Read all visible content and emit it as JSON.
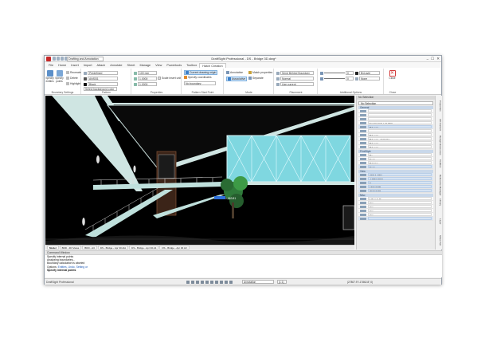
{
  "window": {
    "title": "DraftSight Professional - DS - Bridge 3D.dwg*",
    "workspace": "Drafting and Annotation",
    "controls": [
      "–",
      "☐",
      "✕"
    ]
  },
  "ribbon_tabs": [
    "File",
    "Home",
    "Insert",
    "Import",
    "Attach",
    "Annotate",
    "Sheet",
    "Manage",
    "View",
    "Powertools",
    "Toolbox",
    "Hatch Creation"
  ],
  "ribbon_active_tab": "Hatch Creation",
  "ribbon": {
    "boundary": {
      "label": "Boundary Settings",
      "specify_entities": "Specify entities",
      "specify_points": "Specify points",
      "options": [
        "Recreate",
        "Delete",
        "Highlight"
      ]
    },
    "pattern": {
      "label": "Pattern",
      "type": "Predefined",
      "name": "ANSI31",
      "color": "Black",
      "background": "Select background color"
    },
    "properties": {
      "label": "Properties",
      "angle": "100 mm",
      "scale": "1.0000",
      "spacing": "1.0000",
      "scale_insert": "Scale insert unit"
    },
    "origin": {
      "label": "Pattern Start Point",
      "current_drawing_origin": "Current drawing origin",
      "specify_coordinates": "Specify coordinates",
      "no_boundary": "No boundary"
    },
    "mode": {
      "label": "Mode",
      "annotative": "Annotative",
      "associative": "Associative",
      "match_properties": "Match properties",
      "separate": "Separate"
    },
    "placement": {
      "label": "Placement",
      "order": "Send Behind Boundary",
      "normal": "Normal",
      "layer": "Use current"
    },
    "additional": {
      "label": "Additional Options",
      "color_by": "ByLayer",
      "layer_value": "0",
      "gap": "0",
      "linetype": "None"
    },
    "close": {
      "label": "Close",
      "button": "Close"
    }
  },
  "layout_tabs": [
    "Model",
    "BDD - 3D Views",
    "BDD - A3",
    "DS - Bridge - Apr 30 AIA",
    "DS - Bridge - Apr 30 A4",
    "DS - Bridge - Apr 30 A3"
  ],
  "layout_active": "Model",
  "properties_panel": {
    "header": "No Selection",
    "selection": "No Selection",
    "sections": [
      {
        "title": "General",
        "rows": [
          {
            "value": "",
            "highlight": false
          },
          {
            "value": "",
            "highlight": false
          },
          {
            "value": "",
            "highlight": false
          },
          {
            "value": "Small Hatch Left Wall",
            "highlight": false
          },
          {
            "value": "ByLayer",
            "highlight": true
          },
          {
            "value": "",
            "highlight": false
          },
          {
            "value": "ByLayer",
            "highlight": false
          },
          {
            "value": "ByLayer - Solid line",
            "highlight": false
          },
          {
            "value": "ByLayer",
            "highlight": false
          },
          {
            "value": "ByLayer",
            "highlight": false
          }
        ]
      },
      {
        "title": "PrintStyle",
        "rows": [
          {
            "value": "By",
            "highlight": false
          },
          {
            "value": "None",
            "highlight": false
          },
          {
            "value": "ByColor",
            "highlight": false
          },
          {
            "value": "None",
            "highlight": true
          }
        ]
      },
      {
        "title": "View",
        "rows": [
          {
            "value": "27614.4092",
            "highlight": true
          },
          {
            "value": "-17862.8023",
            "highlight": true
          },
          {
            "value": "0",
            "highlight": true
          },
          {
            "value": "1682.9995",
            "highlight": true
          },
          {
            "value": "3043.6493",
            "highlight": true
          }
        ]
      },
      {
        "title": "Misc",
        "rows": [
          {
            "value": "1/4\" = 1'-0\"",
            "highlight": false
          },
          {
            "value": "Yes",
            "highlight": false
          },
          {
            "value": "Yes",
            "highlight": false
          },
          {
            "value": "Yes",
            "highlight": false
          },
          {
            "value": "Yes",
            "highlight": false
          },
          {
            "value": "",
            "highlight": true
          }
        ]
      }
    ]
  },
  "side_tabs": [
    "Properties",
    "3D Content",
    "Design Resources",
    "Toolbox",
    "Reference Manager",
    "Library",
    "Layer",
    "Sheet Set"
  ],
  "command_window": {
    "title": "Command Window",
    "lines": [
      {
        "text": "Specify internal points",
        "options": ""
      },
      {
        "text": "Analyzing boundaries...",
        "options": ""
      },
      {
        "text": "Boundary calculation is aborted",
        "options": ""
      },
      {
        "text": "Options: ",
        "options": "Entities, Undo, Setting or"
      },
      {
        "text": "Specify internal points",
        "options": ""
      }
    ]
  },
  "status_bar": {
    "app": "DraftSight Professional",
    "annotation": "Annotation",
    "scale": "(1:1)",
    "coordinates": "(27807.9\"/-17862.8\",0)"
  },
  "drawing": {
    "dimension_text": "1,063.81"
  },
  "colors": {
    "accent": "#1f5ea8",
    "cyan_glass": "#7fd7e0",
    "canvas": "#000000",
    "ribbon_highlight": "#cfe3f6"
  }
}
